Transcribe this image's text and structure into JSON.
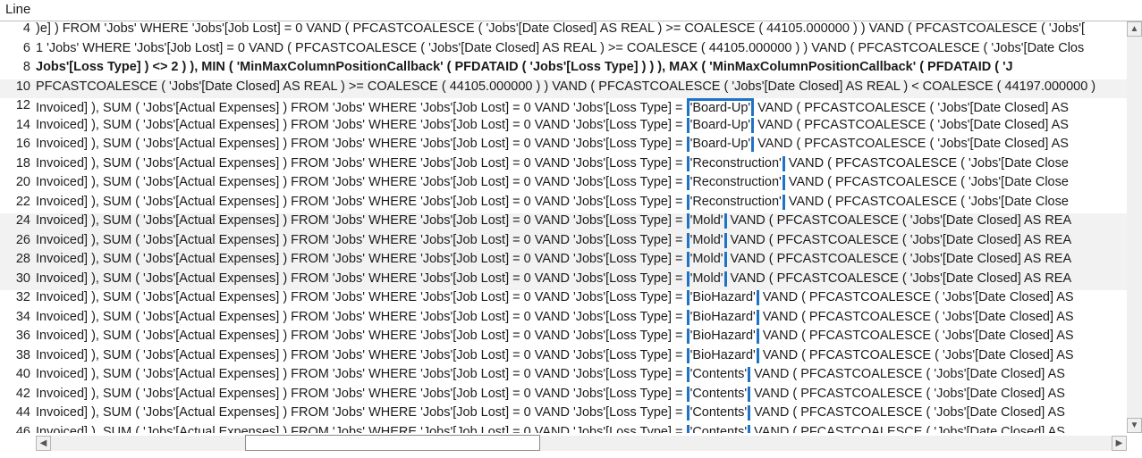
{
  "header": {
    "title": "Line"
  },
  "rows": [
    {
      "n": 4,
      "alt": false,
      "bold": false,
      "pre": ")e] ) FROM 'Jobs' WHERE 'Jobs'[Job Lost] = 0 VAND  ( PFCASTCOALESCE ( 'Jobs'[Date Closed] AS  REAL ) >= COALESCE ( 44105.000000 )  ) VAND  ( PFCASTCOALESCE ( 'Jobs'["
    },
    {
      "n": 6,
      "alt": false,
      "bold": false,
      "pre": "1 'Jobs' WHERE 'Jobs'[Job Lost] = 0 VAND  ( PFCASTCOALESCE ( 'Jobs'[Date Closed] AS  REAL ) >= COALESCE ( 44105.000000 )  ) VAND  ( PFCASTCOALESCE ( 'Jobs'[Date Clos"
    },
    {
      "n": 8,
      "alt": false,
      "bold": true,
      "pre": "Jobs'[Loss Type] ) <> 2 )  ), MIN ( 'MinMaxColumnPositionCallback' ( PFDATAID ( 'Jobs'[Loss Type] )  )  ), MAX ( 'MinMaxColumnPositionCallback' ( PFDATAID ( 'J"
    },
    {
      "n": 10,
      "alt": true,
      "bold": false,
      "pre": "PFCASTCOALESCE ( 'Jobs'[Date Closed] AS  REAL ) >= COALESCE ( 44105.000000 )  ) VAND  ( PFCASTCOALESCE ( 'Jobs'[Date Closed] AS  REAL ) < COALESCE ( 44197.000000 )"
    },
    {
      "n": 12,
      "alt": false,
      "bold": false,
      "pre": "Invoiced] ), SUM ( 'Jobs'[Actual Expenses] ) FROM 'Jobs' WHERE 'Jobs'[Job Lost] = 0 VAND 'Jobs'[Loss Type] = ",
      "hl": "'Board-Up'",
      "hlEdge": "top",
      "post": " VAND  ( PFCASTCOALESCE ( 'Jobs'[Date Closed] AS"
    },
    {
      "n": 14,
      "alt": false,
      "bold": false,
      "pre": "Invoiced] ), SUM ( 'Jobs'[Actual Expenses] ) FROM 'Jobs' WHERE 'Jobs'[Job Lost] = 0 VAND 'Jobs'[Loss Type] = ",
      "hl": "'Board-Up'",
      "hlEdge": "mid",
      "post": " VAND  ( PFCASTCOALESCE ( 'Jobs'[Date Closed] AS"
    },
    {
      "n": 16,
      "alt": false,
      "bold": false,
      "pre": "Invoiced] ), SUM ( 'Jobs'[Actual Expenses] ) FROM 'Jobs' WHERE 'Jobs'[Job Lost] = 0 VAND 'Jobs'[Loss Type] = ",
      "hl": "'Board-Up'",
      "hlEdge": "mid",
      "post": " VAND  ( PFCASTCOALESCE ( 'Jobs'[Date Closed] AS"
    },
    {
      "n": 18,
      "alt": false,
      "bold": false,
      "pre": "Invoiced] ), SUM ( 'Jobs'[Actual Expenses] ) FROM 'Jobs' WHERE 'Jobs'[Job Lost] = 0 VAND 'Jobs'[Loss Type] = ",
      "hl": "'Reconstruction'",
      "hlEdge": "mid",
      "post": " VAND  ( PFCASTCOALESCE ( 'Jobs'[Date Close"
    },
    {
      "n": 20,
      "alt": false,
      "bold": false,
      "pre": "Invoiced] ), SUM ( 'Jobs'[Actual Expenses] ) FROM 'Jobs' WHERE 'Jobs'[Job Lost] = 0 VAND 'Jobs'[Loss Type] = ",
      "hl": "'Reconstruction'",
      "hlEdge": "mid",
      "post": " VAND  ( PFCASTCOALESCE ( 'Jobs'[Date Close"
    },
    {
      "n": 22,
      "alt": false,
      "bold": false,
      "pre": "Invoiced] ), SUM ( 'Jobs'[Actual Expenses] ) FROM 'Jobs' WHERE 'Jobs'[Job Lost] = 0 VAND 'Jobs'[Loss Type] = ",
      "hl": "'Reconstruction'",
      "hlEdge": "mid",
      "post": " VAND  ( PFCASTCOALESCE ( 'Jobs'[Date Close"
    },
    {
      "n": 24,
      "alt": true,
      "bold": false,
      "pre": "Invoiced] ), SUM ( 'Jobs'[Actual Expenses] ) FROM 'Jobs' WHERE 'Jobs'[Job Lost] = 0 VAND 'Jobs'[Loss Type] = ",
      "hl": "'Mold'",
      "hlEdge": "mid",
      "post": " VAND  ( PFCASTCOALESCE ( 'Jobs'[Date Closed] AS  REA"
    },
    {
      "n": 26,
      "alt": true,
      "bold": false,
      "pre": "Invoiced] ), SUM ( 'Jobs'[Actual Expenses] ) FROM 'Jobs' WHERE 'Jobs'[Job Lost] = 0 VAND 'Jobs'[Loss Type] = ",
      "hl": "'Mold'",
      "hlEdge": "mid",
      "post": " VAND  ( PFCASTCOALESCE ( 'Jobs'[Date Closed] AS  REA"
    },
    {
      "n": 28,
      "alt": true,
      "bold": false,
      "pre": "Invoiced] ), SUM ( 'Jobs'[Actual Expenses] ) FROM 'Jobs' WHERE 'Jobs'[Job Lost] = 0 VAND 'Jobs'[Loss Type] = ",
      "hl": "'Mold'",
      "hlEdge": "mid",
      "post": " VAND  ( PFCASTCOALESCE ( 'Jobs'[Date Closed] AS  REA"
    },
    {
      "n": 30,
      "alt": true,
      "bold": false,
      "pre": "Invoiced] ), SUM ( 'Jobs'[Actual Expenses] ) FROM 'Jobs' WHERE 'Jobs'[Job Lost] = 0 VAND 'Jobs'[Loss Type] = ",
      "hl": "'Mold'",
      "hlEdge": "mid",
      "post": " VAND  ( PFCASTCOALESCE ( 'Jobs'[Date Closed] AS  REA"
    },
    {
      "n": 32,
      "alt": false,
      "bold": false,
      "pre": "Invoiced] ), SUM ( 'Jobs'[Actual Expenses] ) FROM 'Jobs' WHERE 'Jobs'[Job Lost] = 0 VAND 'Jobs'[Loss Type] = ",
      "hl": "'BioHazard'",
      "hlEdge": "mid",
      "post": " VAND  ( PFCASTCOALESCE ( 'Jobs'[Date Closed] AS"
    },
    {
      "n": 34,
      "alt": false,
      "bold": false,
      "pre": "Invoiced] ), SUM ( 'Jobs'[Actual Expenses] ) FROM 'Jobs' WHERE 'Jobs'[Job Lost] = 0 VAND 'Jobs'[Loss Type] = ",
      "hl": "'BioHazard'",
      "hlEdge": "mid",
      "post": " VAND  ( PFCASTCOALESCE ( 'Jobs'[Date Closed] AS"
    },
    {
      "n": 36,
      "alt": false,
      "bold": false,
      "pre": "Invoiced] ), SUM ( 'Jobs'[Actual Expenses] ) FROM 'Jobs' WHERE 'Jobs'[Job Lost] = 0 VAND 'Jobs'[Loss Type] = ",
      "hl": "'BioHazard'",
      "hlEdge": "mid",
      "post": " VAND  ( PFCASTCOALESCE ( 'Jobs'[Date Closed] AS"
    },
    {
      "n": 38,
      "alt": false,
      "bold": false,
      "pre": "Invoiced] ), SUM ( 'Jobs'[Actual Expenses] ) FROM 'Jobs' WHERE 'Jobs'[Job Lost] = 0 VAND 'Jobs'[Loss Type] = ",
      "hl": "'BioHazard'",
      "hlEdge": "mid",
      "post": " VAND  ( PFCASTCOALESCE ( 'Jobs'[Date Closed] AS"
    },
    {
      "n": 40,
      "alt": false,
      "bold": false,
      "pre": "Invoiced] ), SUM ( 'Jobs'[Actual Expenses] ) FROM 'Jobs' WHERE 'Jobs'[Job Lost] = 0 VAND 'Jobs'[Loss Type] = ",
      "hl": "'Contents'",
      "hlEdge": "mid",
      "post": " VAND  ( PFCASTCOALESCE ( 'Jobs'[Date Closed] AS"
    },
    {
      "n": 42,
      "alt": false,
      "bold": false,
      "pre": "Invoiced] ), SUM ( 'Jobs'[Actual Expenses] ) FROM 'Jobs' WHERE 'Jobs'[Job Lost] = 0 VAND 'Jobs'[Loss Type] = ",
      "hl": "'Contents'",
      "hlEdge": "mid",
      "post": " VAND  ( PFCASTCOALESCE ( 'Jobs'[Date Closed] AS"
    },
    {
      "n": 44,
      "alt": false,
      "bold": false,
      "pre": "Invoiced] ), SUM ( 'Jobs'[Actual Expenses] ) FROM 'Jobs' WHERE 'Jobs'[Job Lost] = 0 VAND 'Jobs'[Loss Type] = ",
      "hl": "'Contents'",
      "hlEdge": "mid",
      "post": " VAND  ( PFCASTCOALESCE ( 'Jobs'[Date Closed] AS"
    },
    {
      "n": 46,
      "alt": false,
      "bold": false,
      "pre": "Invoiced] ). SUM ( 'Jobs'[Actual Expenses] ) FROM 'Jobs' WHERE 'Jobs'[Job Lost] = 0 VAND 'Jobs'[Loss Type] = ",
      "hl": "'Contents'",
      "hlEdge": "bot",
      "post": " VAND  ( PFCASTCOALESCE ( 'Jobs'[Date Closed] AS"
    }
  ],
  "scroll": {
    "up": "▲",
    "down": "▼",
    "left": "◀",
    "right": "▶"
  }
}
